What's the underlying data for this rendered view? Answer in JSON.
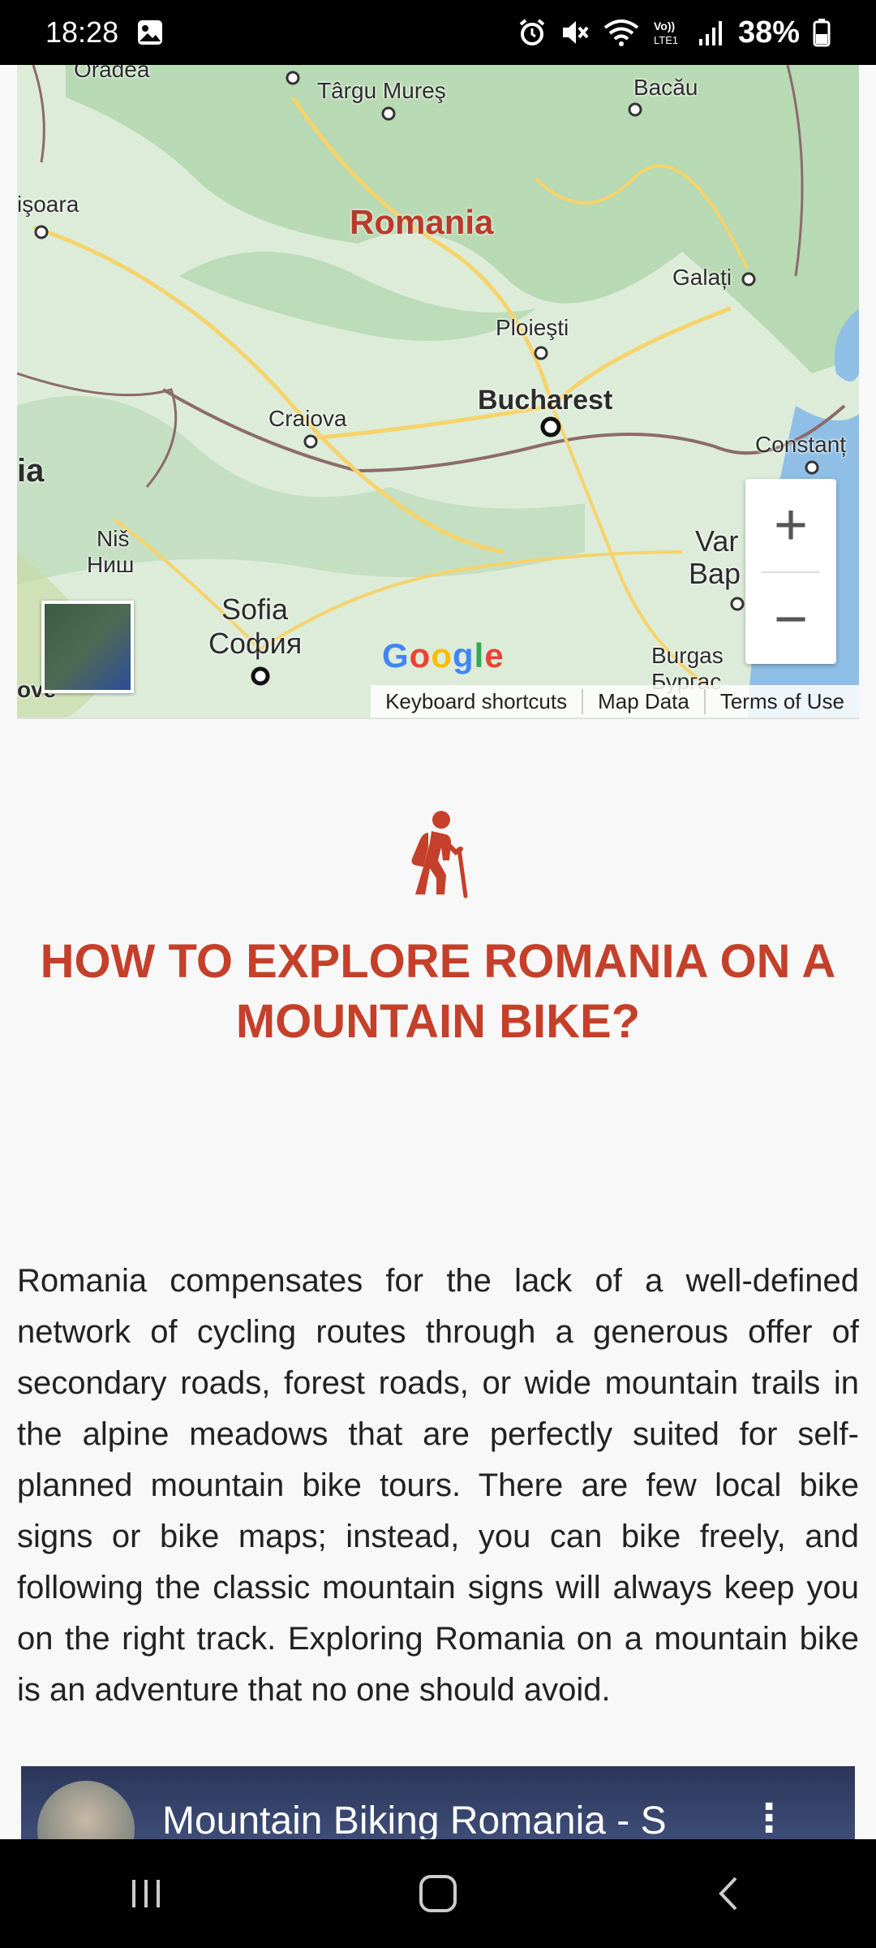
{
  "status_bar": {
    "time": "18:28",
    "battery": "38%",
    "icons": [
      "gallery-icon",
      "alarm-icon",
      "mute-icon",
      "wifi-icon",
      "volte-icon",
      "signal-icon",
      "battery-icon"
    ]
  },
  "map": {
    "country_label": "Romania",
    "places": [
      "Târgu Mureş",
      "Bacău",
      "işoara",
      "Galați",
      "Ploieşti",
      "Bucharest",
      "Craiova",
      "Constanț",
      "Niš",
      "Ниш",
      "Sofia",
      "София",
      "Var",
      "Вар",
      "Burgas",
      "Бургас",
      "ia",
      "ove",
      "Oradea"
    ],
    "google_logo": "Google",
    "attribution": {
      "keyboard_shortcuts": "Keyboard shortcuts",
      "map_data": "Map Data",
      "terms": "Terms of Use"
    },
    "zoom_in": "+",
    "zoom_out": "−",
    "colors": {
      "land": "#d7ead8",
      "forest": "#a8d5a8",
      "water": "#8fbfe6",
      "road": "#f6d36b",
      "border": "#8c6a6a"
    }
  },
  "article": {
    "icon": "hiker-icon",
    "title": "HOW TO EXPLORE ROMANIA ON A MOUNTAIN BIKE?",
    "body": "Romania compensates for the lack of a well-defined network of cycling routes through a generous offer of secondary roads, forest roads, or wide mountain trails in the alpine meadows that are perfectly suited for self-planned mountain bike tours. There are few local bike signs or bike maps; instead, you can bike freely, and following the classic mountain signs will always keep you on the right track. Exploring Romania on a mountain bike is an adventure that no one should avoid.",
    "accent_color": "#c4402a"
  },
  "video": {
    "title": "Mountain Biking Romania - S",
    "more": "⋮"
  },
  "nav_bar": {
    "buttons": [
      "recent-apps",
      "home",
      "back"
    ]
  }
}
